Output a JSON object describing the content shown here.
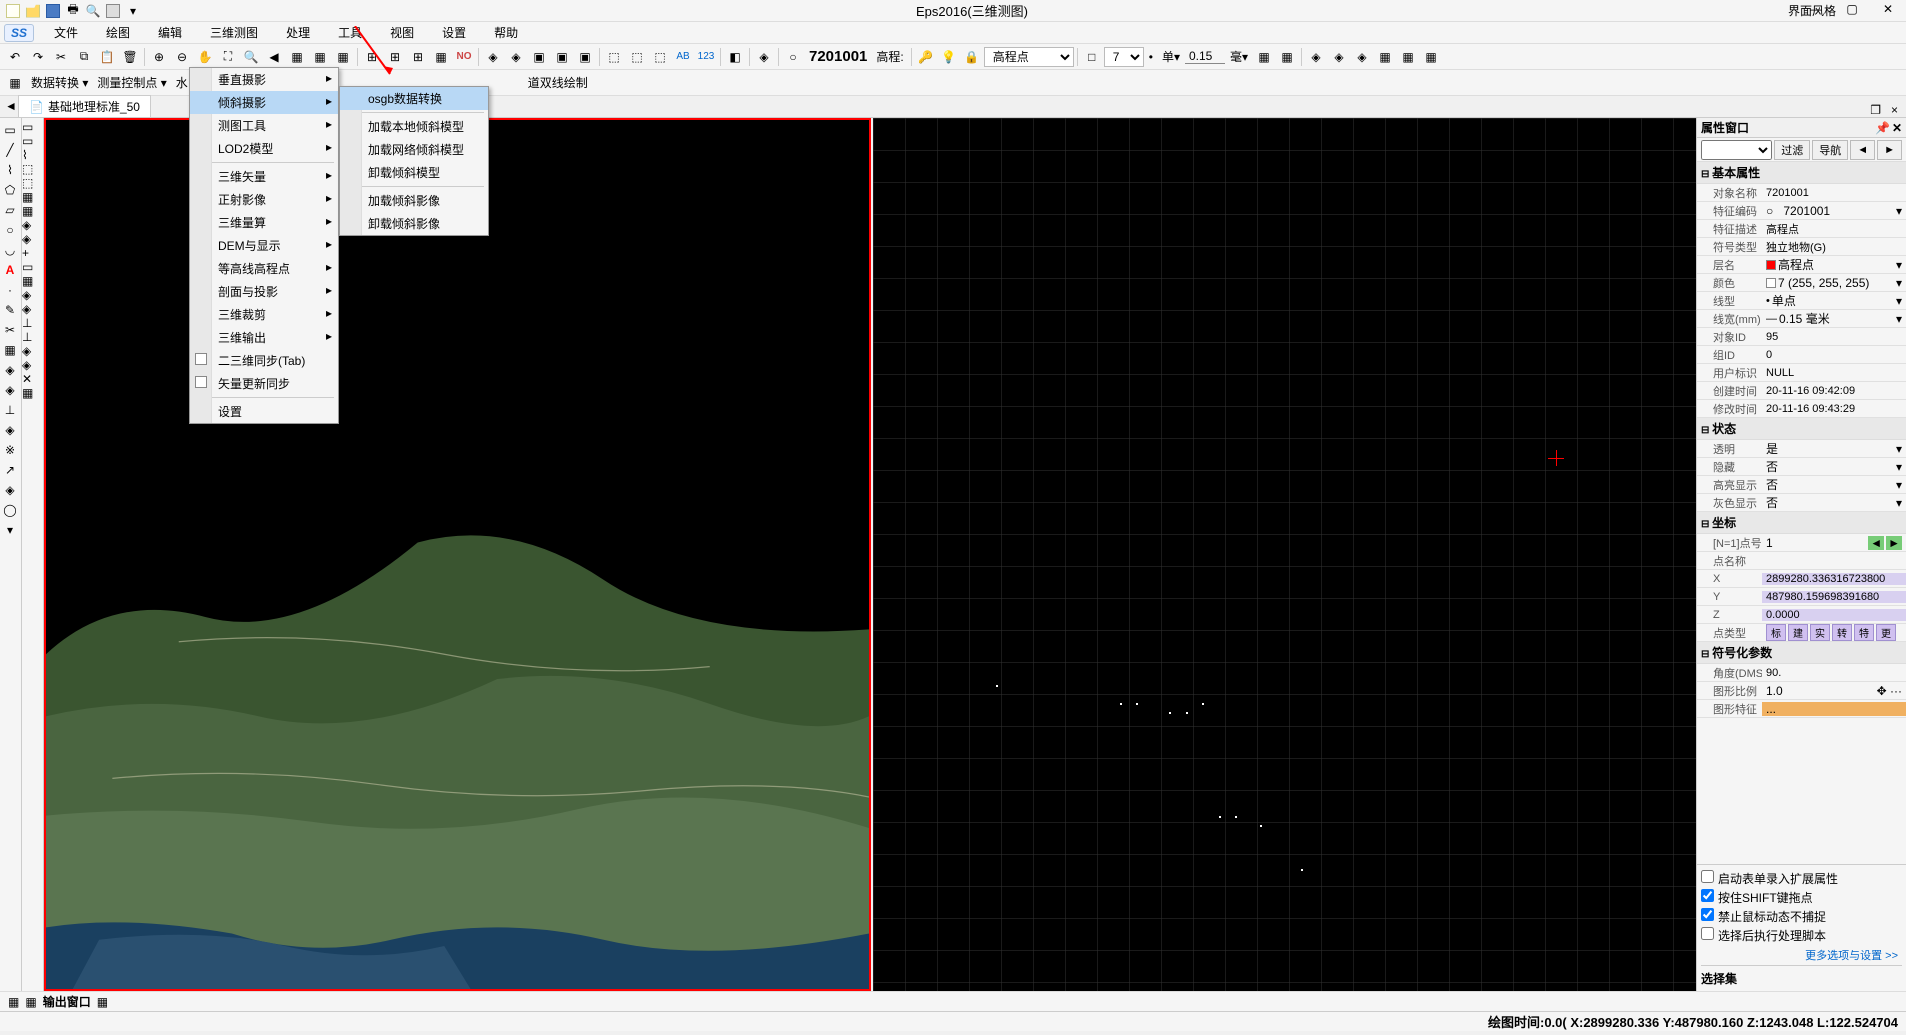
{
  "title": "Eps2016(三维测图)",
  "style_label": "界面风格",
  "qat_dropdown": "▾",
  "app_logo": "SS",
  "menu": {
    "file": "文件",
    "draw": "绘图",
    "edit": "编辑",
    "3dview": "三维测图",
    "process": "处理",
    "tools": "工具",
    "view": "视图",
    "settings": "设置",
    "help": "帮助"
  },
  "toolbar1": {
    "code": "7201001",
    "elev_label": "高程:",
    "elev_point": "高程点",
    "val7": "7",
    "unit_label": "单▾",
    "val015": "0.15",
    "mm": "毫▾"
  },
  "toolbar2": {
    "data_convert": "数据转换 ▾",
    "survey_control": "测量控制点 ▾",
    "water": "水",
    "road_double": "道双线绘制"
  },
  "tabs": {
    "nav_left": "◄",
    "tab1": "基础地理标准_50",
    "close": "×",
    "restore": "❐"
  },
  "dropdown1": {
    "vertical_photo": "垂直摄影",
    "oblique_photo": "倾斜摄影",
    "drawing_tools": "测图工具",
    "lod2_model": "LOD2模型",
    "3d_vector": "三维矢量",
    "ortho_image": "正射影像",
    "3d_compute": "三维量算",
    "dem_display": "DEM与显示",
    "contour_elev": "等高线高程点",
    "profile_proj": "剖面与投影",
    "3d_clip": "三维裁剪",
    "3d_output": "三维输出",
    "sync_23d": "二三维同步(Tab)",
    "vector_update_sync": "矢量更新同步",
    "settings": "设置"
  },
  "dropdown2": {
    "osgb_convert": "osgb数据转换",
    "load_local_oblique": "加载本地倾斜模型",
    "load_network_oblique": "加载网络倾斜模型",
    "unload_oblique_model": "卸载倾斜模型",
    "load_oblique_image": "加载倾斜影像",
    "unload_oblique_image": "卸载倾斜影像"
  },
  "properties_panel": {
    "title": "属性窗口",
    "filter_btn": "过滤",
    "nav_btn": "导航",
    "nav_prev": "◄",
    "nav_next": "►",
    "sections": {
      "basic": "基本属性",
      "status": "状态",
      "coords": "坐标",
      "symbol": "符号化参数"
    },
    "basic": {
      "object_name_label": "对象名称",
      "object_name": "7201001",
      "feature_code_label": "特征编码",
      "feature_code_marker": "○",
      "feature_code": "7201001",
      "feature_desc_label": "特征描述",
      "feature_desc": "高程点",
      "symbol_type_label": "符号类型",
      "symbol_type": "独立地物(G)",
      "layer_label": "层名",
      "layer_color": "#ff0000",
      "layer": "高程点",
      "color_label": "颜色",
      "color": "7 (255, 255, 255)",
      "linetype_label": "线型",
      "linetype": "单点",
      "linewidth_label": "线宽(mm)",
      "linewidth": "0.15 毫米",
      "obj_id_label": "对象ID",
      "obj_id": "95",
      "group_id_label": "组ID",
      "group_id": "0",
      "user_id_label": "用户标识",
      "user_id": "NULL",
      "create_time_label": "创建时间",
      "create_time": "20-11-16 09:42:09",
      "modify_time_label": "修改时间",
      "modify_time": "20-11-16 09:43:29"
    },
    "status": {
      "transparent_label": "透明",
      "transparent": "是",
      "hidden_label": "隐藏",
      "hidden": "否",
      "highlight_label": "高亮显示",
      "highlight": "否",
      "gray_label": "灰色显示",
      "gray": "否"
    },
    "coords": {
      "point_num_label": "[N=1]点号",
      "point_num": "1",
      "point_name_label": "点名称",
      "point_name": "",
      "x_label": "X",
      "x": "2899280.336316723800",
      "y_label": "Y",
      "y": "487980.159698391680",
      "z_label": "Z",
      "z": "0.0000",
      "point_type_label": "点类型",
      "badges": [
        "标",
        "建",
        "实",
        "转",
        "特",
        "更"
      ]
    },
    "symbol": {
      "angle_label": "角度(DMS)",
      "angle": "90.",
      "scale_label": "图形比例",
      "scale": "1.0",
      "graphic_label": "图形特征",
      "graphic": "..."
    },
    "bottom": {
      "enable_form": "启动表单录入扩展属性",
      "hold_shift": "按住SHIFT键拖点",
      "no_dynamic": "禁止鼠标动态不捕捉",
      "exec_script": "选择后执行处理脚本",
      "more_options": "更多选项与设置  >>",
      "select_set": "选择集"
    }
  },
  "output_window": "输出窗口",
  "status_bar": "绘图时间:0.0( X:2899280.336 Y:487980.160 Z:1243.048 L:122.524704"
}
